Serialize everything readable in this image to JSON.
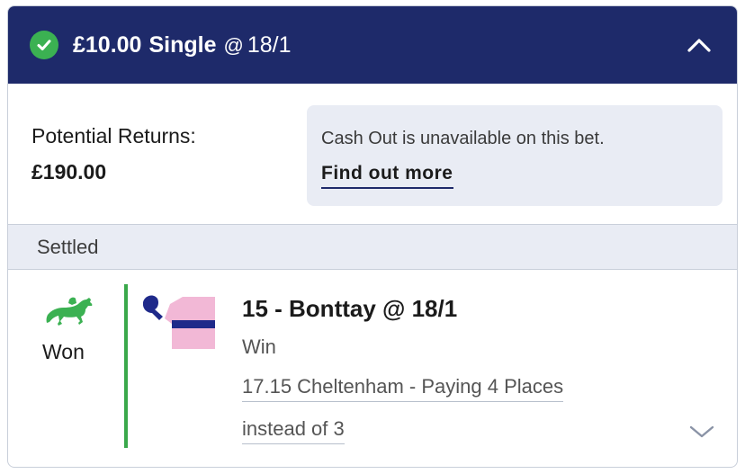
{
  "header": {
    "stake": "£10.00",
    "bet_type": "Single",
    "at": "@",
    "odds": "18/1",
    "status_icon": "check-circle-icon",
    "collapse_icon": "chevron-up-icon"
  },
  "returns": {
    "label": "Potential Returns:",
    "value": "£190.00"
  },
  "cashout": {
    "message": "Cash Out is unavailable on this bet.",
    "link": "Find out more"
  },
  "settled": {
    "label": "Settled"
  },
  "selection": {
    "result_icon": "horse-racing-icon",
    "result": "Won",
    "silks_icon": "jockey-silks-icon",
    "name": "15 - Bonttay @ 18/1",
    "market": "Win",
    "race_line1": "17.15 Cheltenham - Paying 4 Places",
    "race_line2": "instead of 3",
    "expand_icon": "chevron-down-icon"
  },
  "colors": {
    "header_bg": "#1e2a6a",
    "success_green": "#3bb152",
    "panel_bg": "#e9ecf4",
    "silks_pink": "#f2b8d6",
    "silks_navy": "#1f2a8a"
  }
}
